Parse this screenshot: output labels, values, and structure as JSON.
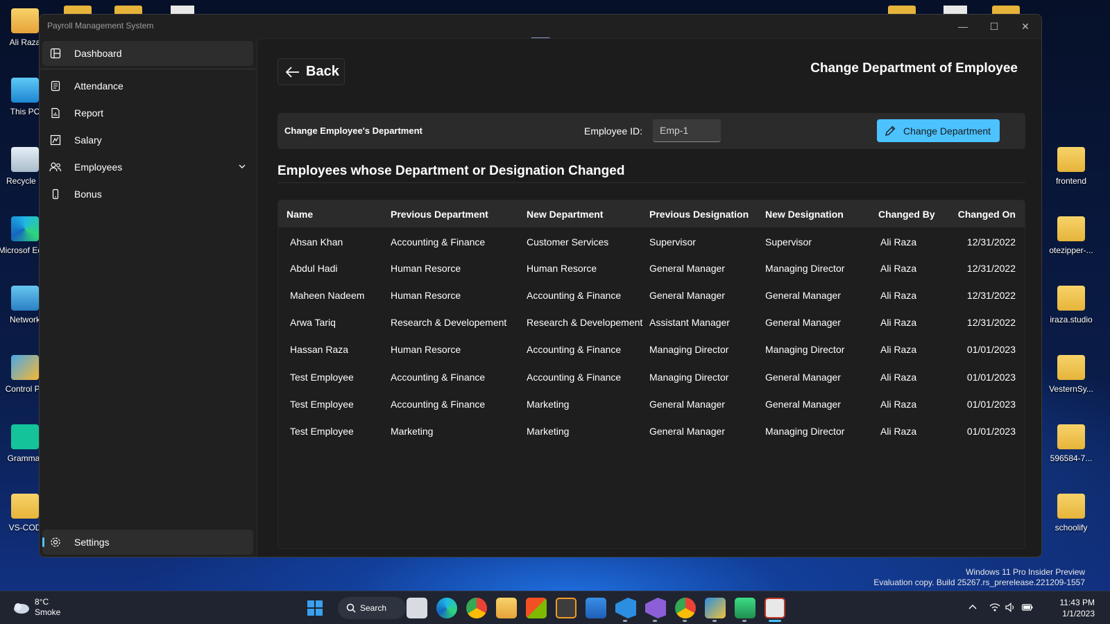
{
  "desktop": {
    "icons_left": [
      {
        "label": "Ali Raza",
        "icon": "user-folder-icon"
      },
      {
        "label": "This PC",
        "icon": "computer-icon"
      },
      {
        "label": "Recycle B",
        "icon": "recycle-bin-icon"
      },
      {
        "label": "Microsof Edge",
        "icon": "edge-icon"
      },
      {
        "label": "Network",
        "icon": "network-icon"
      },
      {
        "label": "Control Pa",
        "icon": "control-panel-icon"
      },
      {
        "label": "Grammar",
        "icon": "grammarly-icon"
      },
      {
        "label": "VS-COD",
        "icon": "folder-icon"
      }
    ],
    "icons_right": [
      {
        "label": "frontend",
        "icon": "folder-icon"
      },
      {
        "label": "otezipper-...",
        "icon": "folder-icon"
      },
      {
        "label": "iraza.studio",
        "icon": "folder-icon"
      },
      {
        "label": "VesternSy...",
        "icon": "chrome-folder-icon"
      },
      {
        "label": "596584-7...",
        "icon": "folder-icon"
      },
      {
        "label": "schoolify",
        "icon": "folder-icon"
      }
    ],
    "watermark_line1": "Windows 11 Pro Insider Preview",
    "watermark_line2": "Evaluation copy. Build 25267.rs_prerelease.221209-1557"
  },
  "window": {
    "title": "Payroll Management System",
    "controls": {
      "minimize": "—",
      "maximize": "☐",
      "close": "✕"
    }
  },
  "sidebar": {
    "items": [
      {
        "label": "Dashboard",
        "icon": "dashboard-icon"
      },
      {
        "label": "Attendance",
        "icon": "attendance-icon"
      },
      {
        "label": "Report",
        "icon": "report-icon"
      },
      {
        "label": "Salary",
        "icon": "salary-icon"
      },
      {
        "label": "Employees",
        "icon": "employees-icon"
      },
      {
        "label": "Bonus",
        "icon": "bonus-icon"
      }
    ],
    "settings_label": "Settings"
  },
  "page": {
    "back_label": "Back",
    "title": "Change Department of Employee",
    "form": {
      "label": "Change Employee's Department",
      "employee_id_label": "Employee ID:",
      "employee_id_value": "Emp-1",
      "button_label": "Change Department"
    },
    "section_title": "Employees whose Department or Designation Changed",
    "table": {
      "columns": [
        "Name",
        "Previous Department",
        "New Department",
        "Previous Designation",
        "New Designation",
        "Changed By",
        "Changed On"
      ],
      "rows": [
        [
          "Ahsan Khan",
          "Accounting & Finance",
          "Customer Services",
          "Supervisor",
          "Supervisor",
          "Ali Raza",
          "12/31/2022"
        ],
        [
          "Abdul Hadi",
          "Human Resorce",
          "Human Resorce",
          "General Manager",
          "Managing Director",
          "Ali Raza",
          "12/31/2022"
        ],
        [
          "Maheen Nadeem",
          "Human Resorce",
          "Accounting & Finance",
          "General Manager",
          "General Manager",
          "Ali Raza",
          "12/31/2022"
        ],
        [
          "Arwa Tariq",
          "Research & Developement",
          "Research & Developement",
          "Assistant Manager",
          "General Manager",
          "Ali Raza",
          "12/31/2022"
        ],
        [
          "Hassan Raza",
          "Human Resorce",
          "Accounting & Finance",
          "Managing Director",
          "Managing Director",
          "Ali Raza",
          "01/01/2023"
        ],
        [
          "Test Employee",
          "Accounting & Finance",
          "Accounting & Finance",
          "Managing Director",
          "General Manager",
          "Ali Raza",
          "01/01/2023"
        ],
        [
          "Test Employee",
          "Accounting & Finance",
          "Marketing",
          "General Manager",
          "General Manager",
          "Ali Raza",
          "01/01/2023"
        ],
        [
          "Test Employee",
          "Marketing",
          "Marketing",
          "General Manager",
          "Managing Director",
          "Ali Raza",
          "01/01/2023"
        ]
      ]
    }
  },
  "taskbar": {
    "weather_temp": "8°C",
    "weather_desc": "Smoke",
    "search_label": "Search",
    "time": "11:43 PM",
    "date": "1/1/2023",
    "apps": [
      "start-icon",
      "search-icon",
      "task-view-icon",
      "edge-icon",
      "chrome-icon",
      "file-explorer-icon",
      "store-icon",
      "sublime-icon",
      "mail-icon",
      "vscode-icon",
      "visual-studio-icon",
      "chrome-profile-icon",
      "snip-icon",
      "android-studio-icon",
      "payroll-app-icon"
    ]
  },
  "colors": {
    "accent": "#4cc2ff",
    "window_bg": "#202020",
    "content_bg": "#1c1c1c",
    "card_bg": "#2b2b2b"
  }
}
